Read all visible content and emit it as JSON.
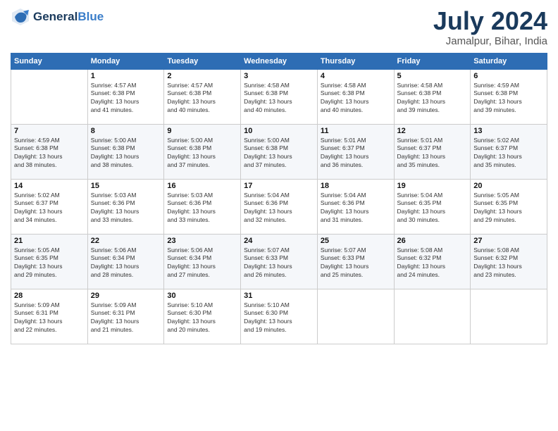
{
  "header": {
    "logo_line1": "General",
    "logo_line2": "Blue",
    "title": "July 2024",
    "subtitle": "Jamalpur, Bihar, India"
  },
  "columns": [
    "Sunday",
    "Monday",
    "Tuesday",
    "Wednesday",
    "Thursday",
    "Friday",
    "Saturday"
  ],
  "weeks": [
    [
      {
        "day": "",
        "info": ""
      },
      {
        "day": "1",
        "info": "Sunrise: 4:57 AM\nSunset: 6:38 PM\nDaylight: 13 hours\nand 41 minutes."
      },
      {
        "day": "2",
        "info": "Sunrise: 4:57 AM\nSunset: 6:38 PM\nDaylight: 13 hours\nand 40 minutes."
      },
      {
        "day": "3",
        "info": "Sunrise: 4:58 AM\nSunset: 6:38 PM\nDaylight: 13 hours\nand 40 minutes."
      },
      {
        "day": "4",
        "info": "Sunrise: 4:58 AM\nSunset: 6:38 PM\nDaylight: 13 hours\nand 40 minutes."
      },
      {
        "day": "5",
        "info": "Sunrise: 4:58 AM\nSunset: 6:38 PM\nDaylight: 13 hours\nand 39 minutes."
      },
      {
        "day": "6",
        "info": "Sunrise: 4:59 AM\nSunset: 6:38 PM\nDaylight: 13 hours\nand 39 minutes."
      }
    ],
    [
      {
        "day": "7",
        "info": "Sunrise: 4:59 AM\nSunset: 6:38 PM\nDaylight: 13 hours\nand 38 minutes."
      },
      {
        "day": "8",
        "info": "Sunrise: 5:00 AM\nSunset: 6:38 PM\nDaylight: 13 hours\nand 38 minutes."
      },
      {
        "day": "9",
        "info": "Sunrise: 5:00 AM\nSunset: 6:38 PM\nDaylight: 13 hours\nand 37 minutes."
      },
      {
        "day": "10",
        "info": "Sunrise: 5:00 AM\nSunset: 6:38 PM\nDaylight: 13 hours\nand 37 minutes."
      },
      {
        "day": "11",
        "info": "Sunrise: 5:01 AM\nSunset: 6:37 PM\nDaylight: 13 hours\nand 36 minutes."
      },
      {
        "day": "12",
        "info": "Sunrise: 5:01 AM\nSunset: 6:37 PM\nDaylight: 13 hours\nand 35 minutes."
      },
      {
        "day": "13",
        "info": "Sunrise: 5:02 AM\nSunset: 6:37 PM\nDaylight: 13 hours\nand 35 minutes."
      }
    ],
    [
      {
        "day": "14",
        "info": "Sunrise: 5:02 AM\nSunset: 6:37 PM\nDaylight: 13 hours\nand 34 minutes."
      },
      {
        "day": "15",
        "info": "Sunrise: 5:03 AM\nSunset: 6:36 PM\nDaylight: 13 hours\nand 33 minutes."
      },
      {
        "day": "16",
        "info": "Sunrise: 5:03 AM\nSunset: 6:36 PM\nDaylight: 13 hours\nand 33 minutes."
      },
      {
        "day": "17",
        "info": "Sunrise: 5:04 AM\nSunset: 6:36 PM\nDaylight: 13 hours\nand 32 minutes."
      },
      {
        "day": "18",
        "info": "Sunrise: 5:04 AM\nSunset: 6:36 PM\nDaylight: 13 hours\nand 31 minutes."
      },
      {
        "day": "19",
        "info": "Sunrise: 5:04 AM\nSunset: 6:35 PM\nDaylight: 13 hours\nand 30 minutes."
      },
      {
        "day": "20",
        "info": "Sunrise: 5:05 AM\nSunset: 6:35 PM\nDaylight: 13 hours\nand 29 minutes."
      }
    ],
    [
      {
        "day": "21",
        "info": "Sunrise: 5:05 AM\nSunset: 6:35 PM\nDaylight: 13 hours\nand 29 minutes."
      },
      {
        "day": "22",
        "info": "Sunrise: 5:06 AM\nSunset: 6:34 PM\nDaylight: 13 hours\nand 28 minutes."
      },
      {
        "day": "23",
        "info": "Sunrise: 5:06 AM\nSunset: 6:34 PM\nDaylight: 13 hours\nand 27 minutes."
      },
      {
        "day": "24",
        "info": "Sunrise: 5:07 AM\nSunset: 6:33 PM\nDaylight: 13 hours\nand 26 minutes."
      },
      {
        "day": "25",
        "info": "Sunrise: 5:07 AM\nSunset: 6:33 PM\nDaylight: 13 hours\nand 25 minutes."
      },
      {
        "day": "26",
        "info": "Sunrise: 5:08 AM\nSunset: 6:32 PM\nDaylight: 13 hours\nand 24 minutes."
      },
      {
        "day": "27",
        "info": "Sunrise: 5:08 AM\nSunset: 6:32 PM\nDaylight: 13 hours\nand 23 minutes."
      }
    ],
    [
      {
        "day": "28",
        "info": "Sunrise: 5:09 AM\nSunset: 6:31 PM\nDaylight: 13 hours\nand 22 minutes."
      },
      {
        "day": "29",
        "info": "Sunrise: 5:09 AM\nSunset: 6:31 PM\nDaylight: 13 hours\nand 21 minutes."
      },
      {
        "day": "30",
        "info": "Sunrise: 5:10 AM\nSunset: 6:30 PM\nDaylight: 13 hours\nand 20 minutes."
      },
      {
        "day": "31",
        "info": "Sunrise: 5:10 AM\nSunset: 6:30 PM\nDaylight: 13 hours\nand 19 minutes."
      },
      {
        "day": "",
        "info": ""
      },
      {
        "day": "",
        "info": ""
      },
      {
        "day": "",
        "info": ""
      }
    ]
  ]
}
